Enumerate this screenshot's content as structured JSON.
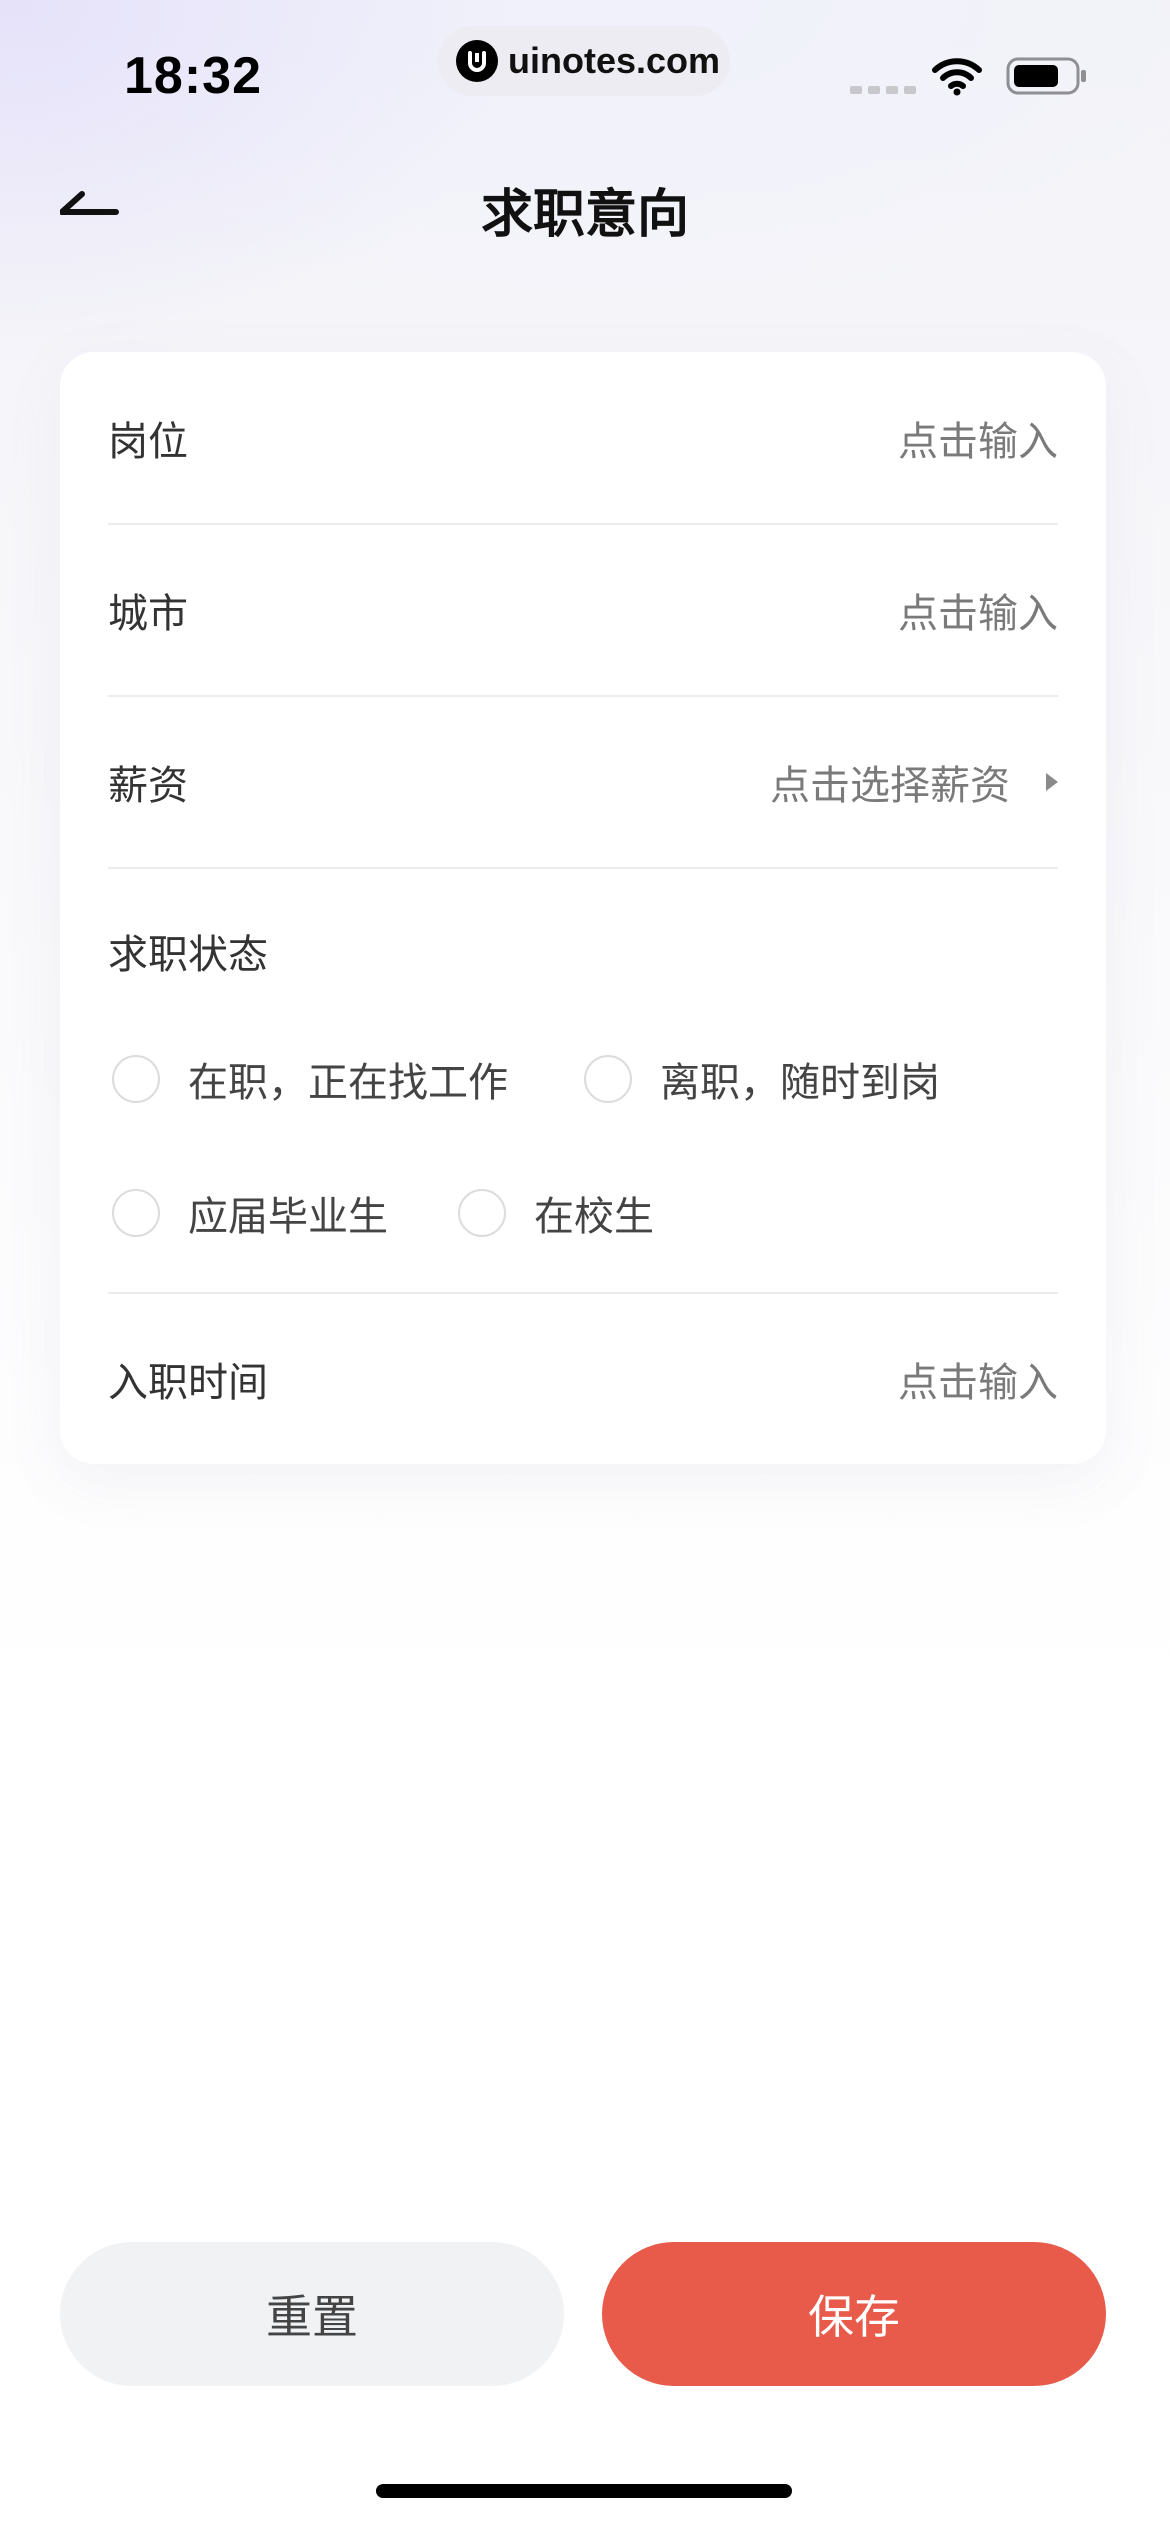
{
  "status_bar": {
    "time": "18:32",
    "url": "uinotes.com",
    "icons": [
      "signal-icon",
      "wifi-icon",
      "battery-icon"
    ]
  },
  "header": {
    "title": "求职意向",
    "back_icon": "back-arrow-icon"
  },
  "form": {
    "position": {
      "label": "岗位",
      "value": "点击输入"
    },
    "city": {
      "label": "城市",
      "value": "点击输入"
    },
    "salary": {
      "label": "薪资",
      "value": "点击选择薪资",
      "icon": "triangle-right-icon"
    },
    "job_status": {
      "label": "求职状态",
      "options": [
        {
          "label": "在职，正在找工作",
          "selected": false
        },
        {
          "label": "离职，随时到岗",
          "selected": false
        },
        {
          "label": "应届毕业生",
          "selected": false
        },
        {
          "label": "在校生",
          "selected": false
        }
      ]
    },
    "start_time": {
      "label": "入职时间",
      "value": "点击输入"
    }
  },
  "buttons": {
    "reset_label": "重置",
    "save_label": "保存"
  },
  "colors": {
    "accent": "#e85a4a",
    "secondary_button": "#f1f2f4",
    "placeholder_text": "#7a7a7a"
  }
}
